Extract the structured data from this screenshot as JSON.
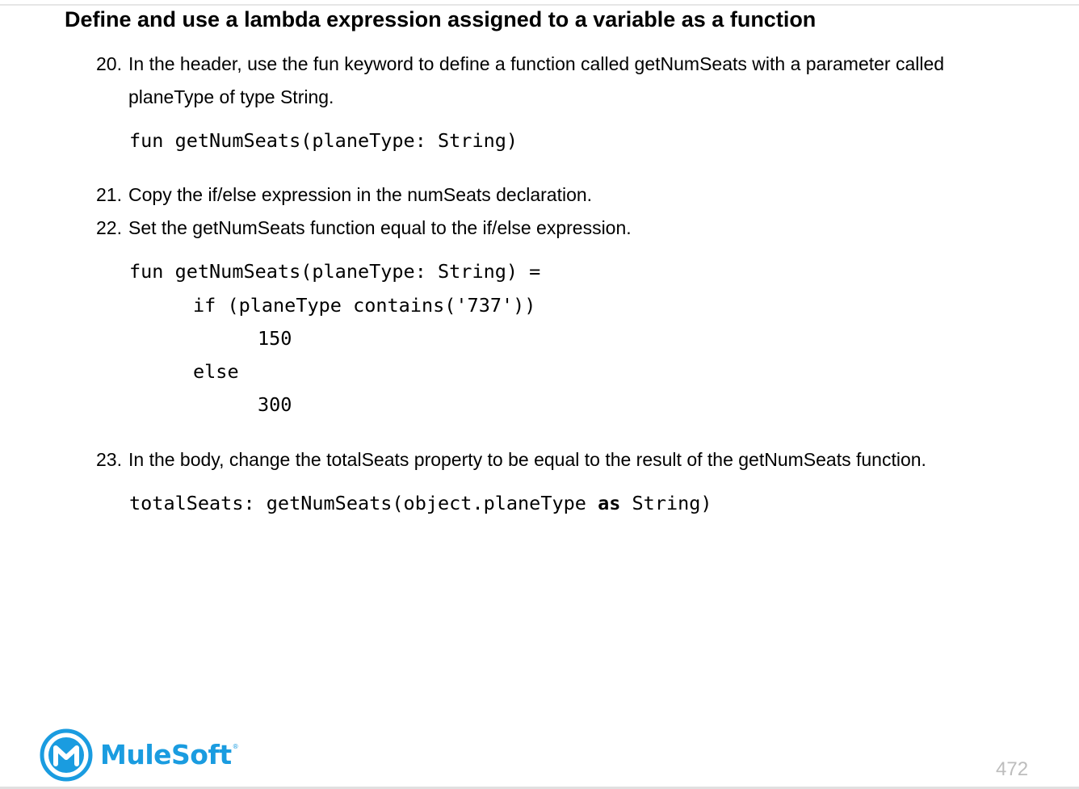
{
  "title": "Define and use a lambda expression assigned to a variable as a function",
  "steps": [
    {
      "number": "20.",
      "text": "In the header, use the fun keyword to define a function called getNumSeats with a parameter called planeType of type String."
    },
    {
      "number": "21.",
      "text": "Copy the if/else expression in the numSeats declaration."
    },
    {
      "number": "22.",
      "text": "Set the getNumSeats function equal to the if/else expression."
    },
    {
      "number": "23.",
      "text": "In the body, change the totalSeats property to be equal to the result of the getNumSeats function."
    }
  ],
  "code": {
    "block1": "fun getNumSeats(planeType: String)",
    "block2": [
      "fun getNumSeats(planeType: String) =",
      "if (planeType contains('737'))",
      "150",
      "else",
      "300"
    ],
    "block3": {
      "before": "totalSeats: getNumSeats(object.planeType ",
      "keyword": "as",
      "after": " String)"
    }
  },
  "footer": {
    "brand": "MuleSoft",
    "trademark": "®",
    "page_number": "472"
  },
  "colors": {
    "brand_blue": "#1a9ce0",
    "page_number_gray": "#bdbdbd"
  },
  "icons": {
    "logo": "mulesoft-logo-icon"
  }
}
